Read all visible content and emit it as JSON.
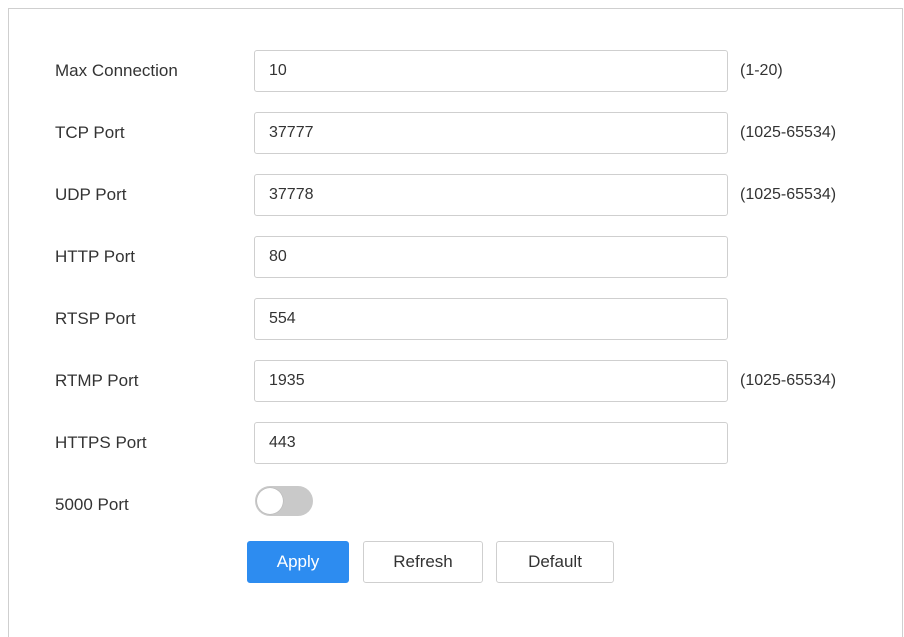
{
  "fields": [
    {
      "label": "Max Connection",
      "value": "10",
      "hint": "(1-20)"
    },
    {
      "label": "TCP Port",
      "value": "37777",
      "hint": "(1025-65534)"
    },
    {
      "label": "UDP Port",
      "value": "37778",
      "hint": "(1025-65534)"
    },
    {
      "label": "HTTP Port",
      "value": "80",
      "hint": ""
    },
    {
      "label": "RTSP Port",
      "value": "554",
      "hint": ""
    },
    {
      "label": "RTMP Port",
      "value": "1935",
      "hint": "(1025-65534)"
    },
    {
      "label": "HTTPS Port",
      "value": "443",
      "hint": ""
    }
  ],
  "toggle": {
    "label": "5000 Port",
    "enabled": false
  },
  "buttons": {
    "apply": "Apply",
    "refresh": "Refresh",
    "default": "Default"
  },
  "colors": {
    "primary": "#2d8cf0",
    "border": "#cfcfcf",
    "toggle_off": "#c9c9c9",
    "text": "#333333"
  }
}
